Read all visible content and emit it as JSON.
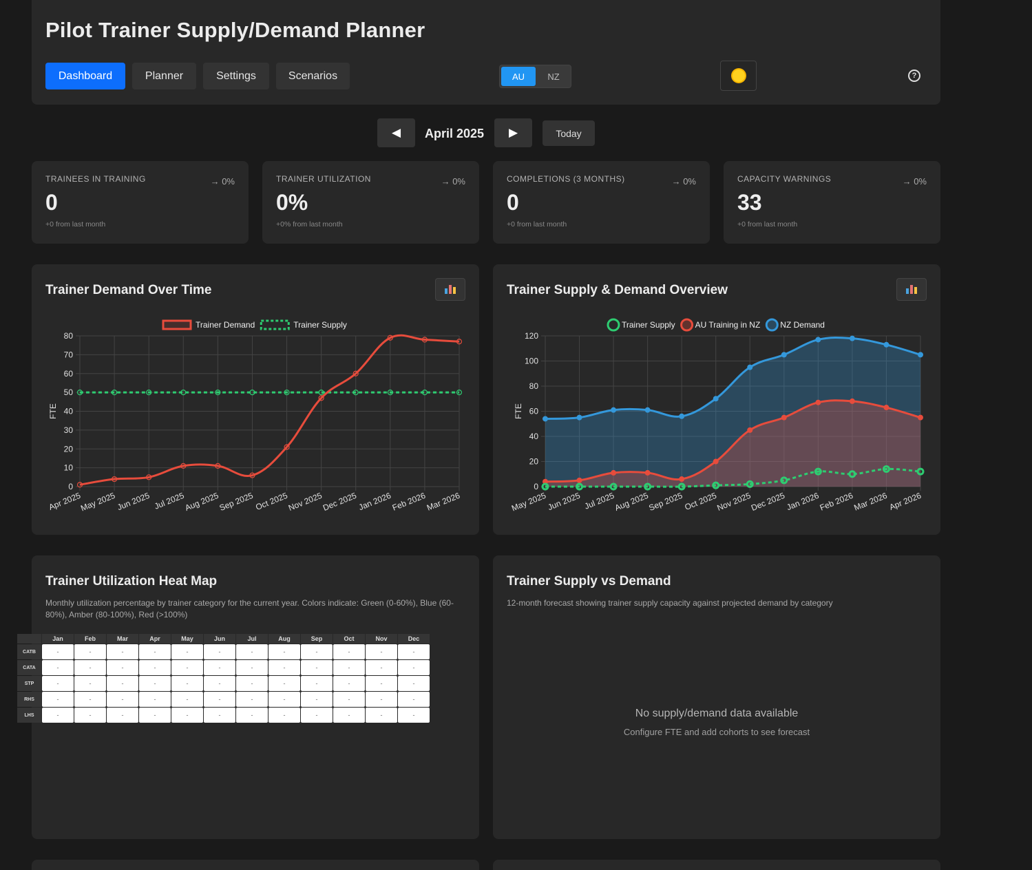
{
  "header": {
    "title": "Pilot Trainer Supply/Demand Planner",
    "nav": [
      "Dashboard",
      "Planner",
      "Settings",
      "Scenarios"
    ],
    "active_nav": "Dashboard",
    "regions": [
      "AU",
      "NZ"
    ],
    "active_region": "AU",
    "theme_icon": "sun-icon",
    "help_icon": "question-circle-icon",
    "help_glyph": "?"
  },
  "month_nav": {
    "prev_glyph": "◀",
    "next_glyph": "▶",
    "current": "April 2025",
    "today_label": "Today"
  },
  "stats": [
    {
      "label": "Trainees in Training",
      "trend": "→ 0%",
      "value": "0",
      "sub": "+0 from last month"
    },
    {
      "label": "Trainer Utilization",
      "trend": "→ 0%",
      "value": "0%",
      "sub": "+0% from last month"
    },
    {
      "label": "Completions (3 months)",
      "trend": "→ 0%",
      "value": "0",
      "sub": "+0 from last month"
    },
    {
      "label": "Capacity Warnings",
      "trend": "→ 0%",
      "value": "33",
      "sub": "+0 from last month"
    }
  ],
  "panels": {
    "demand_title": "Trainer Demand Over Time",
    "overview_title": "Trainer Supply & Demand Overview",
    "heatmap_title": "Trainer Utilization Heat Map",
    "heatmap_desc": "Monthly utilization percentage by trainer category for the current year. Colors indicate: Green (0-60%), Blue (60-80%), Amber (80-100%), Red (>100%)",
    "svd_title": "Trainer Supply vs Demand",
    "svd_desc": "12-month forecast showing trainer supply capacity against projected demand by category",
    "svd_empty_title": "No supply/demand data available",
    "svd_empty_sub": "Configure FTE and add cohorts to see forecast"
  },
  "heatmap": {
    "months": [
      "Jan",
      "Feb",
      "Mar",
      "Apr",
      "May",
      "Jun",
      "Jul",
      "Aug",
      "Sep",
      "Oct",
      "Nov",
      "Dec"
    ],
    "rows": [
      "CATB",
      "CATA",
      "STP",
      "RHS",
      "LHS"
    ],
    "empty_value": "-"
  },
  "chart_data": [
    {
      "type": "line",
      "title": "Trainer Demand Over Time",
      "ylabel": "FTE",
      "ylim": [
        0,
        80
      ],
      "yticks": [
        0,
        10,
        20,
        30,
        40,
        50,
        60,
        70,
        80
      ],
      "grid": true,
      "legend": "top",
      "categories": [
        "Apr 2025",
        "May 2025",
        "Jun 2025",
        "Jul 2025",
        "Aug 2025",
        "Sep 2025",
        "Oct 2025",
        "Nov 2025",
        "Dec 2025",
        "Jan 2026",
        "Feb 2026",
        "Mar 2026"
      ],
      "series": [
        {
          "name": "Trainer Demand",
          "color": "#e74c3c",
          "dashed": false,
          "values": [
            1,
            4,
            5,
            11,
            11,
            6,
            21,
            47,
            60,
            79,
            78,
            77
          ]
        },
        {
          "name": "Trainer Supply",
          "color": "#2ecc71",
          "dashed": true,
          "values": [
            50,
            50,
            50,
            50,
            50,
            50,
            50,
            50,
            50,
            50,
            50,
            50
          ]
        }
      ]
    },
    {
      "type": "area",
      "title": "Trainer Supply & Demand Overview",
      "ylabel": "FTE",
      "ylim": [
        0,
        120
      ],
      "yticks": [
        0,
        20,
        40,
        60,
        80,
        100,
        120
      ],
      "grid": true,
      "legend": "top",
      "categories": [
        "May 2025",
        "Jun 2025",
        "Jul 2025",
        "Aug 2025",
        "Sep 2025",
        "Oct 2025",
        "Nov 2025",
        "Dec 2025",
        "Jan 2026",
        "Feb 2026",
        "Mar 2026",
        "Apr 2026"
      ],
      "series": [
        {
          "name": "Trainer Supply",
          "color": "#2ecc71",
          "dashed": true,
          "fill": false,
          "values": [
            0,
            0,
            0,
            0,
            0,
            1,
            2,
            5,
            12,
            10,
            14,
            12
          ]
        },
        {
          "name": "AU Training in NZ",
          "color": "#e74c3c",
          "dashed": false,
          "fill": true,
          "values": [
            4,
            5,
            11,
            11,
            6,
            20,
            45,
            55,
            67,
            68,
            63,
            55
          ]
        },
        {
          "name": "NZ Demand",
          "color": "#3498db",
          "dashed": false,
          "fill": true,
          "values": [
            54,
            55,
            61,
            61,
            56,
            70,
            95,
            105,
            117,
            118,
            113,
            105
          ]
        }
      ]
    }
  ]
}
